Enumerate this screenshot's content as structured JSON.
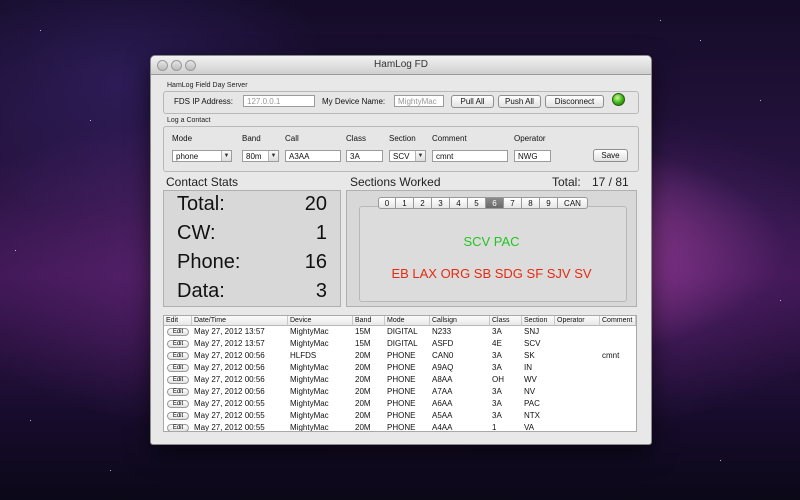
{
  "window": {
    "title": "HamLog FD"
  },
  "server": {
    "group_label": "HamLog Field Day Server",
    "fds_ip_label": "FDS IP Address:",
    "fds_ip_placeholder": "127.0.0.1",
    "device_label": "My Device Name:",
    "device_placeholder": "MightyMac",
    "pull_all": "Pull All",
    "push_all": "Push All",
    "disconnect": "Disconnect",
    "status_color": "#3cae14"
  },
  "log": {
    "group_label": "Log a Contact",
    "mode_label": "Mode",
    "mode_value": "phone",
    "band_label": "Band",
    "band_value": "80m",
    "call_label": "Call",
    "call_value": "A3AA",
    "class_label": "Class",
    "class_value": "3A",
    "section_label": "Section",
    "section_value": "SCV",
    "comment_label": "Comment",
    "comment_value": "cmnt",
    "operator_label": "Operator",
    "operator_value": "NWG",
    "save": "Save"
  },
  "stats": {
    "heading": "Contact Stats",
    "total_label": "Total:",
    "total_value": "20",
    "cw_label": "CW:",
    "cw_value": "1",
    "phone_label": "Phone:",
    "phone_value": "16",
    "data_label": "Data:",
    "data_value": "3"
  },
  "sections": {
    "heading": "Sections Worked",
    "total_label": "Total:",
    "total_value": "17 / 81",
    "tabs": [
      "0",
      "1",
      "2",
      "3",
      "4",
      "5",
      "6",
      "7",
      "8",
      "9",
      "CAN"
    ],
    "selected_tab": "6",
    "worked_text": "SCV PAC",
    "worked_color": "#22c422",
    "missing_text": "EB LAX ORG SB SDG SF SJV SV",
    "missing_color": "#e62a12"
  },
  "table": {
    "headers": [
      "Edit",
      "Date/Time",
      "Device",
      "Band",
      "Mode",
      "Callsign",
      "Class",
      "Section",
      "Operator",
      "Comment"
    ],
    "edit_label": "Edit",
    "rows": [
      [
        "May 27, 2012 13:57",
        "MightyMac",
        "15M",
        "DIGITAL",
        "N233",
        "3A",
        "SNJ",
        "",
        ""
      ],
      [
        "May 27, 2012 13:57",
        "MightyMac",
        "15M",
        "DIGITAL",
        "ASFD",
        "4E",
        "SCV",
        "",
        ""
      ],
      [
        "May 27, 2012 00:56",
        "HLFDS",
        "20M",
        "PHONE",
        "CAN0",
        "3A",
        "SK",
        "",
        "cmnt"
      ],
      [
        "May 27, 2012 00:56",
        "MightyMac",
        "20M",
        "PHONE",
        "A9AQ",
        "3A",
        "IN",
        "",
        ""
      ],
      [
        "May 27, 2012 00:56",
        "MightyMac",
        "20M",
        "PHONE",
        "A8AA",
        "OH",
        "WV",
        "",
        ""
      ],
      [
        "May 27, 2012 00:56",
        "MightyMac",
        "20M",
        "PHONE",
        "A7AA",
        "3A",
        "NV",
        "",
        ""
      ],
      [
        "May 27, 2012 00:55",
        "MightyMac",
        "20M",
        "PHONE",
        "A6AA",
        "3A",
        "PAC",
        "",
        ""
      ],
      [
        "May 27, 2012 00:55",
        "MightyMac",
        "20M",
        "PHONE",
        "A5AA",
        "3A",
        "NTX",
        "",
        ""
      ],
      [
        "May 27, 2012 00:55",
        "MightyMac",
        "20M",
        "PHONE",
        "A4AA",
        "1",
        "VA",
        "",
        ""
      ]
    ]
  }
}
